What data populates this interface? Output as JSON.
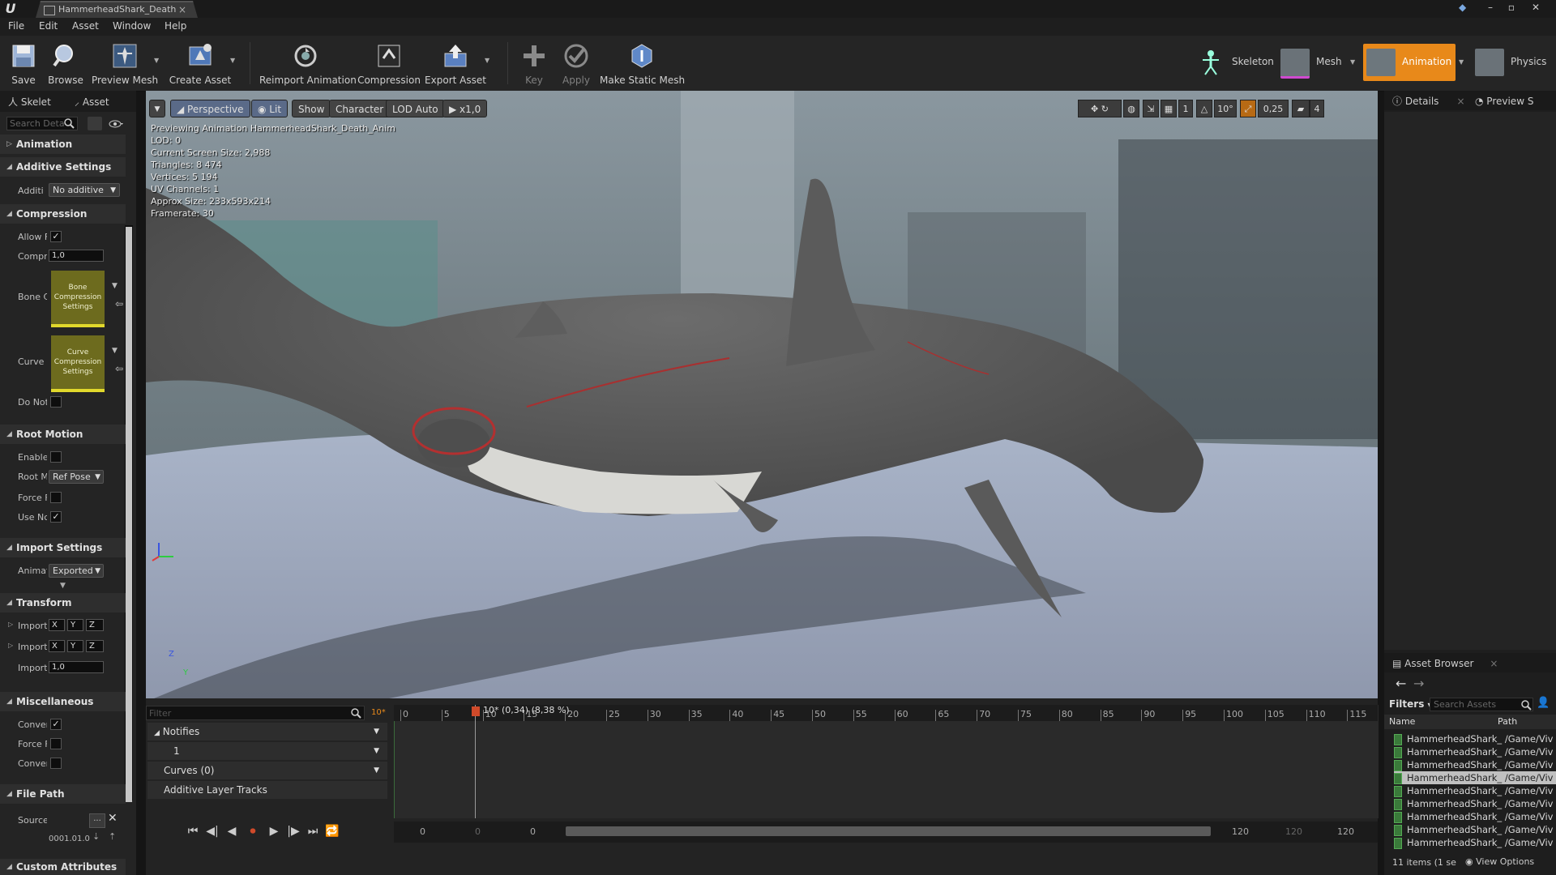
{
  "titlebar": {
    "tab_title": "HammerheadShark_Death"
  },
  "menu": {
    "file": "File",
    "edit": "Edit",
    "asset": "Asset",
    "window": "Window",
    "help": "Help"
  },
  "toolbar": {
    "save": "Save",
    "browse": "Browse",
    "preview_mesh": "Preview Mesh",
    "create_asset": "Create Asset",
    "reimport": "Reimport Animation",
    "compression": "Compression",
    "export_asset": "Export Asset",
    "key": "Key",
    "apply": "Apply",
    "make_static_mesh": "Make Static Mesh",
    "modes": {
      "skeleton": "Skeleton",
      "mesh": "Mesh",
      "animation": "Animation",
      "physics": "Physics"
    },
    "active_mode": "Animation",
    "accent": "#e8891a"
  },
  "left_panel": {
    "tabs": {
      "skeleton": "Skelet",
      "asset": "Asset"
    },
    "search_placeholder": "Search Deta",
    "categories": {
      "animation": "Animation",
      "additive": "Additive Settings",
      "compression": "Compression",
      "root_motion": "Root Motion",
      "import": "Import Settings",
      "transform": "Transform",
      "misc": "Miscellaneous",
      "file_path": "File Path",
      "custom": "Custom Attributes"
    },
    "props": {
      "additive_label": "Additi",
      "additive_value": "No additive",
      "allow_label": "Allow F",
      "allow_checked": "✓",
      "compr_label": "Compr",
      "compr_value": "1,0",
      "bone_label": "Bone C",
      "bone_thumb": "Bone Compression Settings",
      "curve_label": "Curve (",
      "curve_thumb": "Curve Compression Settings",
      "donot_label": "Do Not",
      "enable_label": "Enable",
      "rootm_label": "Root M",
      "rootm_value": "Ref Pose",
      "force_label": "Force F",
      "usenc_label": "Use Nc",
      "usenc_checked": "✓",
      "animat_label": "Animat",
      "animat_value": "Exported",
      "import1_label": "Import",
      "import2_label": "Import",
      "import3_label": "Import",
      "import3_value": "1,0",
      "x": "X",
      "y": "Y",
      "z": "Z",
      "conver1_label": "Conver",
      "conver1_checked": "✓",
      "forcef_label": "Force F",
      "conver2_label": "Conver",
      "source_label": "Source",
      "source_browse": "...",
      "version": "0001.01.0"
    }
  },
  "viewport": {
    "buttons": {
      "perspective": "Perspective",
      "lit": "Lit",
      "show": "Show",
      "character": "Character",
      "lod": "LOD Auto",
      "speed": "x1,0"
    },
    "stats": [
      "Previewing Animation HammerheadShark_Death_Anim",
      "LOD: 0",
      "Current Screen Size: 2,988",
      "Triangles: 8 474",
      "Vertices: 5 194",
      "UV Channels: 1",
      "Approx Size: 233x593x214",
      "Framerate: 30"
    ],
    "right_controls": {
      "rot_snap": "10°",
      "scale_snap": "0,25",
      "camera_speed": "4",
      "layer_count": "1"
    },
    "axis": {
      "z": "Z",
      "y": "Y"
    }
  },
  "timeline": {
    "filter_placeholder": "Filter",
    "frame_indicator": "10*",
    "playhead_label": "10* (0,34) (8,38 %)",
    "ticks": [
      "0",
      "5",
      "10",
      "15",
      "20",
      "25",
      "30",
      "35",
      "40",
      "45",
      "50",
      "55",
      "60",
      "65",
      "70",
      "75",
      "80",
      "85",
      "90",
      "95",
      "100",
      "105",
      "110",
      "115"
    ],
    "tracks": {
      "notifies": "Notifies",
      "notify_track": "1",
      "curves": "Curves",
      "curves_count": "(0)",
      "additive": "Additive Layer Tracks"
    },
    "range": {
      "start": "0",
      "start2": "0",
      "start3": "0",
      "end": "120",
      "end2": "120",
      "end3": "120"
    }
  },
  "right_panel": {
    "tabs": {
      "details": "Details",
      "preview": "Preview S"
    },
    "asset_browser_title": "Asset Browser",
    "filters": "Filters",
    "search_placeholder": "Search Assets",
    "col_name": "Name",
    "col_path": "Path",
    "assets": [
      "HammerheadShark_  /Game/Viv",
      "HammerheadShark_  /Game/Viv",
      "HammerheadShark_  /Game/Viv",
      "HammerheadShark_  /Game/Viv",
      "HammerheadShark_  /Game/Viv",
      "HammerheadShark_  /Game/Viv",
      "HammerheadShark_  /Game/Viv",
      "HammerheadShark_  /Game/Viv",
      "HammerheadShark_  /Game/Viv",
      "HammerheadShark_  /Game/Viv",
      "HammerheadShark_  /Game/Viv"
    ],
    "selected_index": 3,
    "footer_count": "11 items (1 se",
    "view_options": "View Options"
  }
}
